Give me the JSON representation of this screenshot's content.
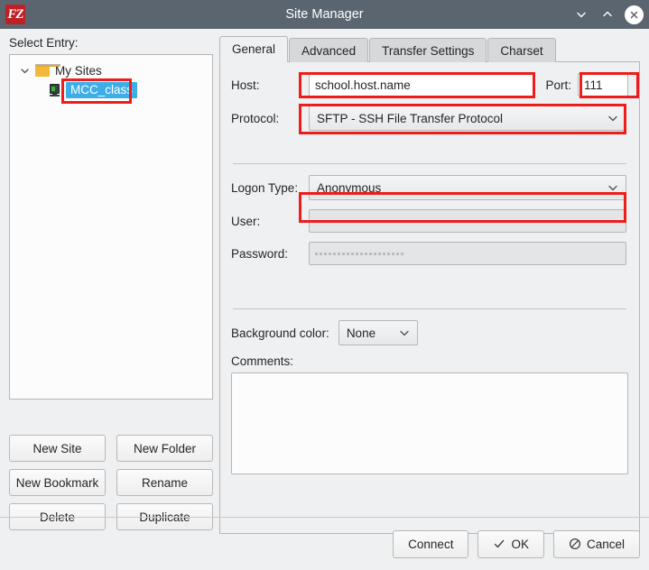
{
  "window": {
    "title": "Site Manager",
    "logo_text": "FZ",
    "logo_color": "#bf2026",
    "titlebar_color": "#5b6570",
    "controls": [
      {
        "name": "minimize",
        "icon": "chevron-down-icon"
      },
      {
        "name": "maximize",
        "icon": "chevron-up-icon"
      },
      {
        "name": "close",
        "icon": "close-icon"
      }
    ]
  },
  "left_panel": {
    "label": "Select Entry:",
    "tree": [
      {
        "label": "My Sites",
        "icon": "folder-icon",
        "expander": "chevron-down-icon",
        "level": 0,
        "selected": false
      },
      {
        "label": "MCC_class",
        "icon": "server-icon",
        "level": 1,
        "selected": true
      }
    ],
    "buttons": [
      {
        "label": "New Site",
        "name": "new-site-button"
      },
      {
        "label": "New Folder",
        "name": "new-folder-button"
      },
      {
        "label": "New Bookmark",
        "name": "new-bookmark-button"
      },
      {
        "label": "Rename",
        "name": "rename-button"
      },
      {
        "label": "Delete",
        "name": "delete-button"
      },
      {
        "label": "Duplicate",
        "name": "duplicate-button"
      }
    ]
  },
  "tabs": [
    {
      "label": "General",
      "active": true
    },
    {
      "label": "Advanced",
      "active": false
    },
    {
      "label": "Transfer Settings",
      "active": false
    },
    {
      "label": "Charset",
      "active": false
    }
  ],
  "general": {
    "host_label": "Host:",
    "host_value": "school.host.name",
    "port_label": "Port:",
    "port_value": "111",
    "protocol_label": "Protocol:",
    "protocol_value": "SFTP - SSH File Transfer Protocol",
    "logon_type_label": "Logon Type:",
    "logon_type_value": "Anonymous",
    "user_label": "User:",
    "user_value": "",
    "password_label": "Password:",
    "password_dots": 20,
    "background_color_label": "Background color:",
    "background_color_value": "None",
    "comments_label": "Comments:",
    "comments_value": ""
  },
  "footer": {
    "connect_label": "Connect",
    "ok_label": "OK",
    "cancel_label": "Cancel"
  },
  "annotation_color": "#ee1c1c"
}
